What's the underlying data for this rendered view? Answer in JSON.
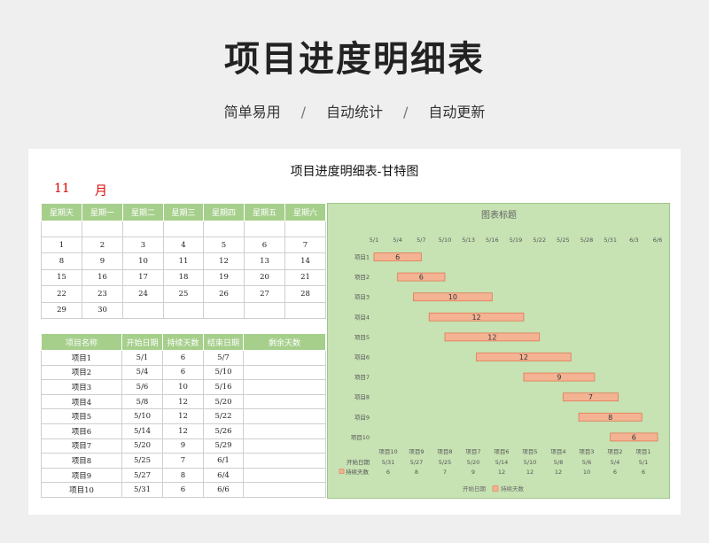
{
  "header": {
    "title": "项目进度明细表",
    "tags": [
      "简单易用",
      "自动统计",
      "自动更新"
    ],
    "separator": "/"
  },
  "sheet": {
    "title": "项目进度明细表-甘特图",
    "month_number": "11",
    "month_unit": "月"
  },
  "calendar": {
    "weekdays": [
      "星期天",
      "星期一",
      "星期二",
      "星期三",
      "星期四",
      "星期五",
      "星期六"
    ],
    "weeks": [
      [
        "",
        "",
        "",
        "",
        "",
        "",
        ""
      ],
      [
        "1",
        "2",
        "3",
        "4",
        "5",
        "6",
        "7"
      ],
      [
        "8",
        "9",
        "10",
        "11",
        "12",
        "13",
        "14"
      ],
      [
        "15",
        "16",
        "17",
        "18",
        "19",
        "20",
        "21"
      ],
      [
        "22",
        "23",
        "24",
        "25",
        "26",
        "27",
        "28"
      ],
      [
        "29",
        "30",
        "",
        "",
        "",
        "",
        ""
      ]
    ]
  },
  "projects": {
    "headers": [
      "项目名称",
      "开始日期",
      "持续天数",
      "结束日期",
      "剩余天数"
    ],
    "rows": [
      [
        "项目1",
        "5/1",
        "6",
        "5/7",
        ""
      ],
      [
        "项目2",
        "5/4",
        "6",
        "5/10",
        ""
      ],
      [
        "项目3",
        "5/6",
        "10",
        "5/16",
        ""
      ],
      [
        "项目4",
        "5/8",
        "12",
        "5/20",
        ""
      ],
      [
        "项目5",
        "5/10",
        "12",
        "5/22",
        ""
      ],
      [
        "项目6",
        "5/14",
        "12",
        "5/26",
        ""
      ],
      [
        "项目7",
        "5/20",
        "9",
        "5/29",
        ""
      ],
      [
        "项目8",
        "5/25",
        "7",
        "6/1",
        ""
      ],
      [
        "项目9",
        "5/27",
        "8",
        "6/4",
        ""
      ],
      [
        "项目10",
        "5/31",
        "6",
        "6/6",
        ""
      ]
    ]
  },
  "chart_data": {
    "type": "bar",
    "orientation": "horizontal-stacked-gantt",
    "title": "图表标题",
    "categories": [
      "项目1",
      "项目2",
      "项目3",
      "项目4",
      "项目5",
      "项目6",
      "项目7",
      "项目8",
      "项目9",
      "项目10"
    ],
    "x_ticks": [
      "5/1",
      "5/4",
      "5/7",
      "5/10",
      "5/13",
      "5/16",
      "5/19",
      "5/22",
      "5/25",
      "5/28",
      "5/31",
      "6/3",
      "6/6"
    ],
    "xlim": [
      "5/1",
      "6/6"
    ],
    "series": [
      {
        "name": "开始日期",
        "values": [
          "5/1",
          "5/4",
          "5/6",
          "5/8",
          "5/10",
          "5/14",
          "5/20",
          "5/25",
          "5/27",
          "5/31"
        ],
        "visible": false
      },
      {
        "name": "持续天数",
        "values": [
          6,
          6,
          10,
          12,
          12,
          12,
          9,
          7,
          8,
          6
        ],
        "color": "#f4b393",
        "border_color": "#e07a56"
      }
    ],
    "data_table": {
      "categories": [
        "项目10",
        "项目9",
        "项目8",
        "项目7",
        "项目6",
        "项目5",
        "项目4",
        "项目3",
        "项目2",
        "项目1"
      ],
      "rows": [
        {
          "label": "开始日期",
          "values": [
            "5/31",
            "5/27",
            "5/25",
            "5/20",
            "5/14",
            "5/10",
            "5/8",
            "5/6",
            "5/4",
            "5/1"
          ]
        },
        {
          "label": "持续天数",
          "values": [
            "6",
            "8",
            "7",
            "9",
            "12",
            "12",
            "12",
            "10",
            "6",
            "6"
          ]
        }
      ]
    },
    "legend": [
      "开始日期",
      "持续天数"
    ],
    "legend_position": "bottom",
    "grid": false
  }
}
